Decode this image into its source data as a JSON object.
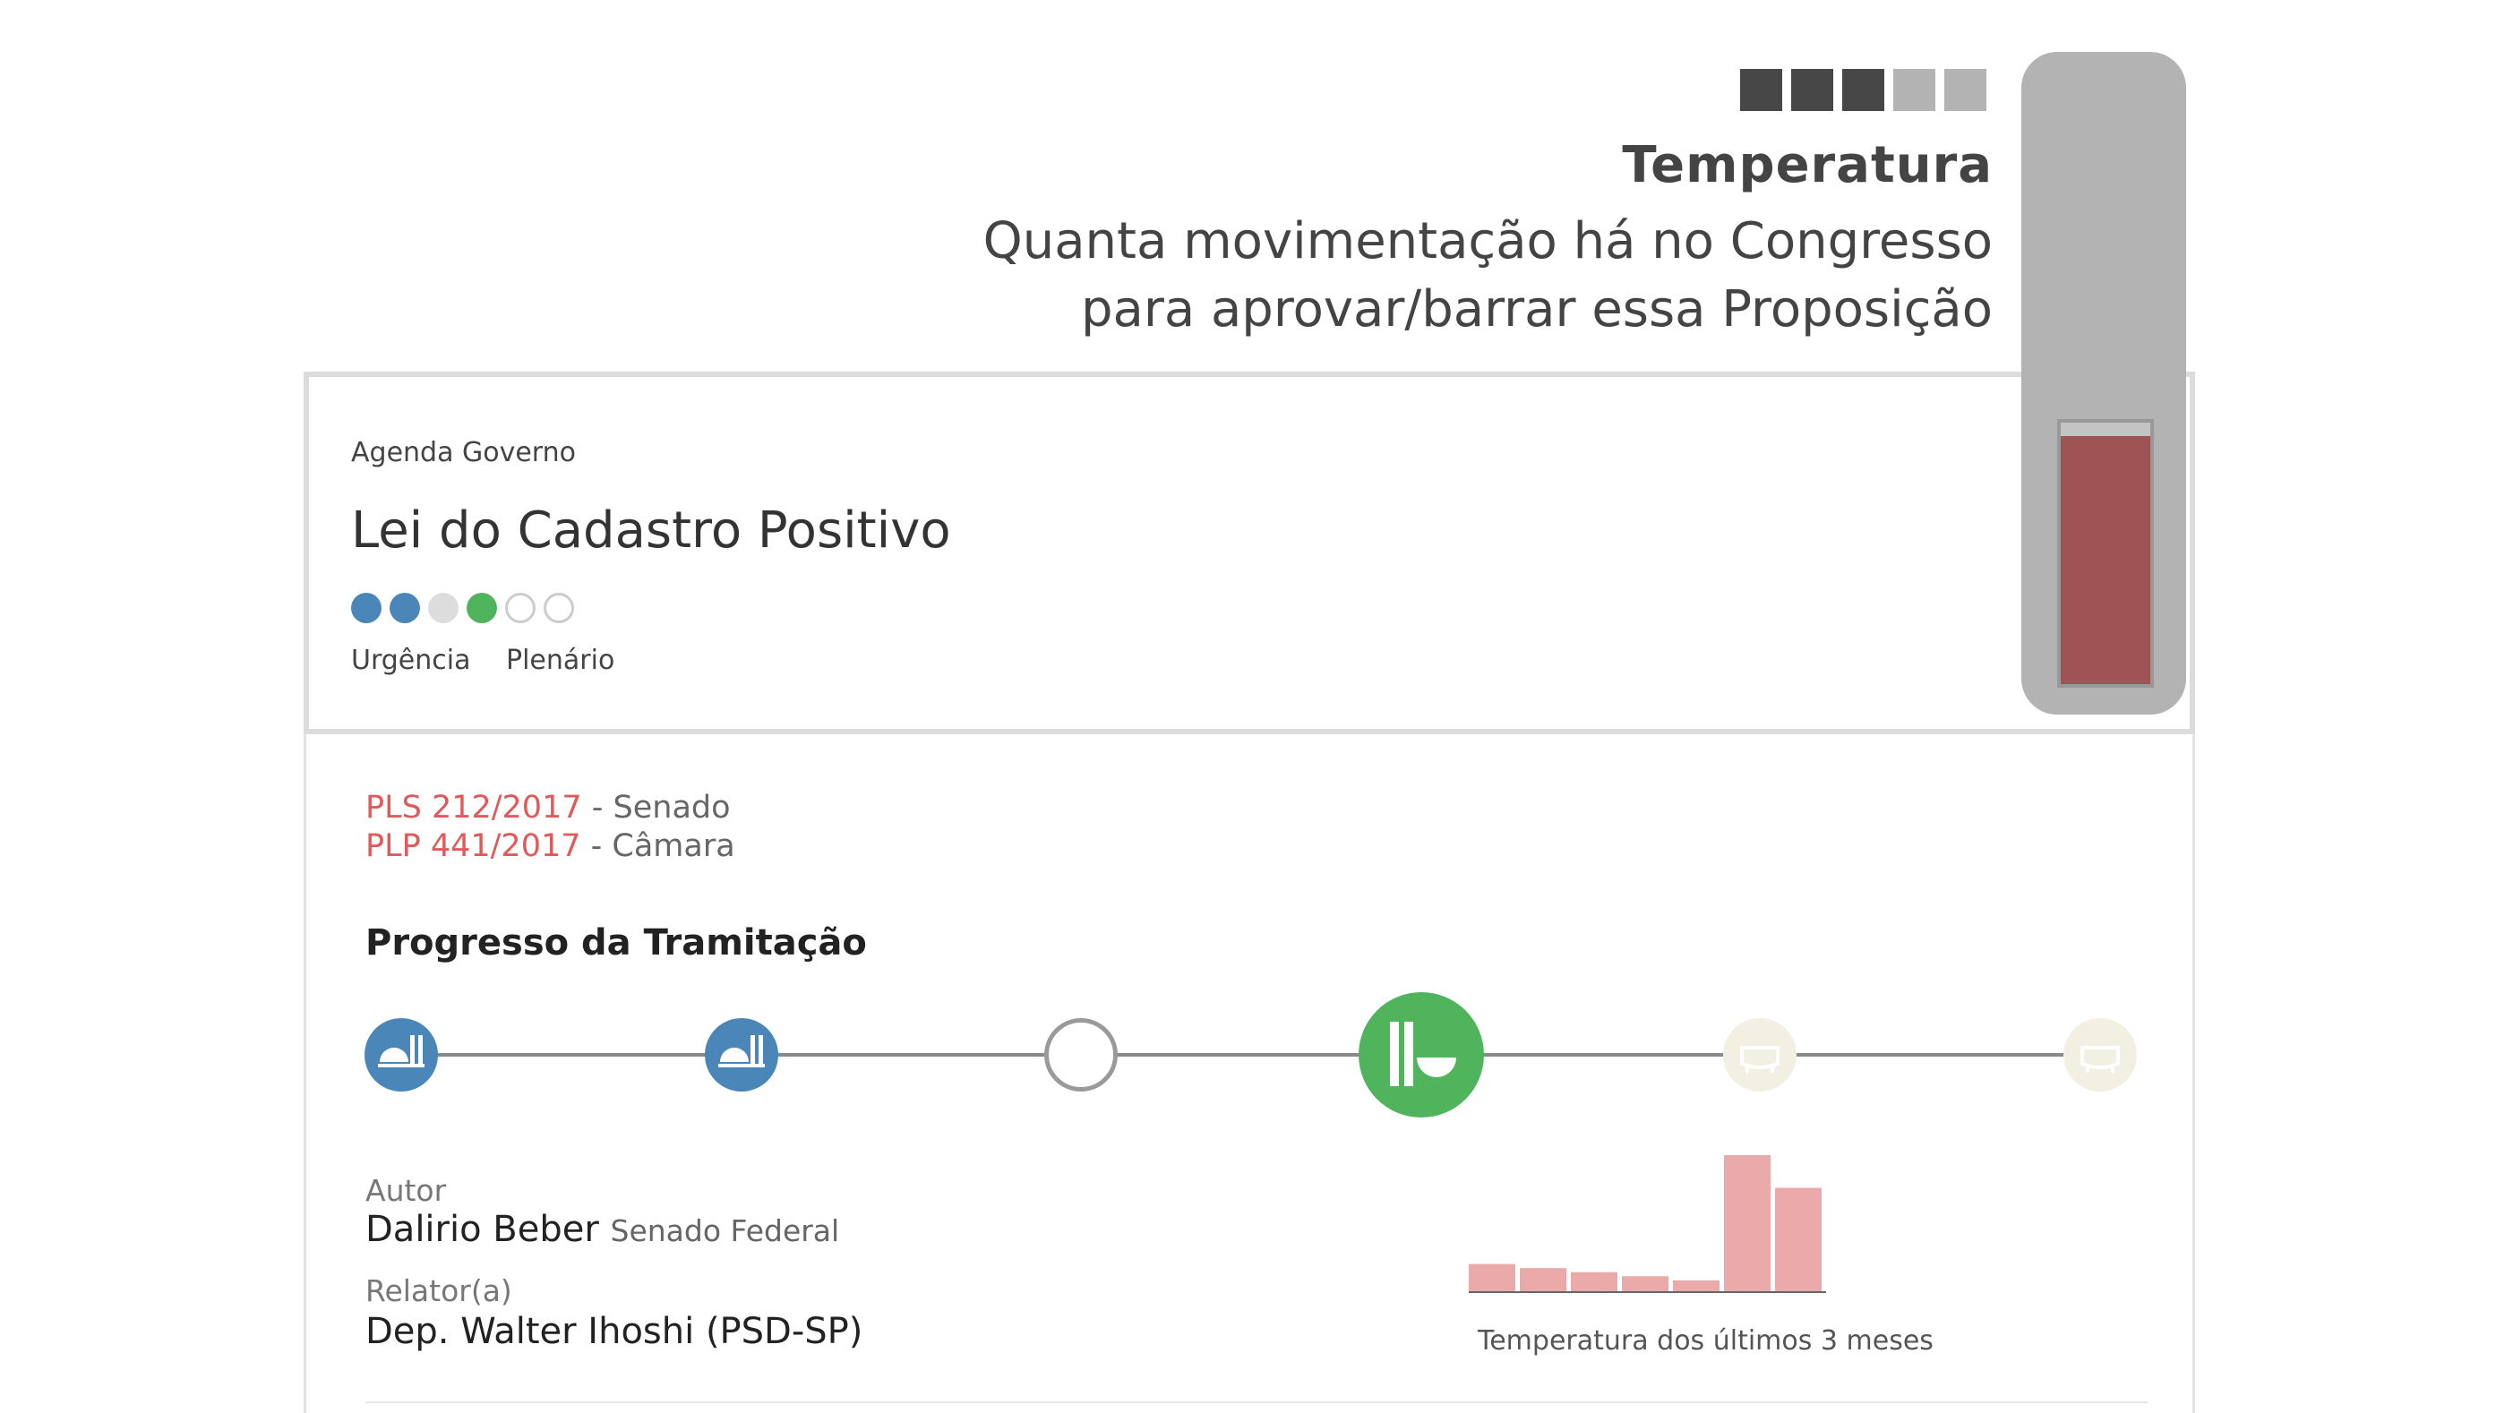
{
  "temperature": {
    "level": 3,
    "max_level": 5,
    "title": "Temperatura",
    "description_line1": "Quanta movimentação há no Congresso",
    "description_line2": "para aprovar/barrar essa Proposição",
    "thermometer_fill_fraction": 0.95,
    "colors": {
      "active": "#474747",
      "inactive": "#b3b3b3",
      "fill": "#9e5454"
    }
  },
  "card": {
    "agenda": "Agenda Governo",
    "title": "Lei do Cadastro Positivo",
    "status_dots": [
      "blue",
      "blue",
      "gray",
      "green",
      "empty",
      "empty"
    ],
    "dot_labels": [
      "Urgência",
      "Plenário"
    ],
    "propositions": [
      {
        "code": "PLS 212/2017",
        "house": " - Senado"
      },
      {
        "code": "PLP 441/2017",
        "house": " - Câmara"
      }
    ],
    "progress": {
      "title": "Progresso da Tramitação",
      "steps": [
        {
          "state": "done",
          "icon": "senate-chamber-icon"
        },
        {
          "state": "done",
          "icon": "senate-chamber-icon"
        },
        {
          "state": "pending",
          "icon": ""
        },
        {
          "state": "current",
          "icon": "plenary-chamber-icon"
        },
        {
          "state": "future",
          "icon": "president-sanction-icon"
        },
        {
          "state": "future",
          "icon": "president-sanction-icon"
        }
      ]
    },
    "author_label": "Autor",
    "author_name": "Dalirio Beber",
    "author_institution": "Senado Federal",
    "rapporteur_label": "Relator(a)",
    "rapporteur_name": "Dep. Walter Ihoshi (PSD-SP)"
  },
  "chart_data": {
    "type": "bar",
    "caption": "Temperatura dos últimos 3 meses",
    "values": [
      20,
      17,
      14,
      11,
      8,
      100,
      76
    ],
    "color": "#eaaaaa"
  }
}
